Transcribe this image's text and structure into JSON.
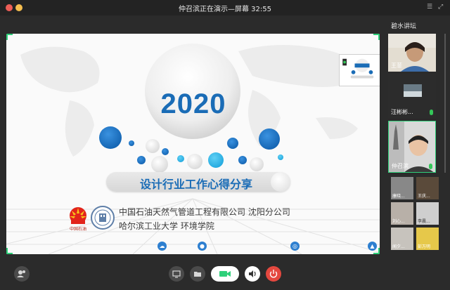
{
  "window": {
    "title": "仲召滨正在演示—屏幕 32:55"
  },
  "slide": {
    "year": "2020",
    "subtitle": "设计行业工作心得分享",
    "org_line1": "中国石油天然气管道工程有限公司   沈阳分公司",
    "org_line2": "哈尔滨工业大学   环境学院",
    "logo_text": "中国石油",
    "accent_color": "#1a6cb6"
  },
  "panel": {
    "title": "碧水讲坛",
    "participants": [
      {
        "name": "王菲",
        "icon": "video-feed"
      },
      {
        "name": "汪彬彬...",
        "icon": "video-feed"
      },
      {
        "name": "仲召滨",
        "icon": "video-feed"
      }
    ],
    "small_participants": [
      {
        "name": "康晓...",
        "icon": "avatar"
      },
      {
        "name": "王庆...",
        "icon": "avatar"
      },
      {
        "name": "刘心...",
        "icon": "avatar"
      },
      {
        "name": "李晨...",
        "icon": "avatar"
      },
      {
        "name": "闻夕...",
        "icon": "avatar"
      },
      {
        "name": "彭万明",
        "icon": "avatar"
      }
    ]
  },
  "toolbar": {
    "members_icon": "members-icon",
    "share_icon": "screen-share-icon",
    "file_icon": "folder-icon",
    "video_icon": "camera-icon",
    "audio_icon": "speaker-icon",
    "end_icon": "power-icon",
    "end_color": "#e4483f",
    "video_color": "#2fd07a"
  }
}
